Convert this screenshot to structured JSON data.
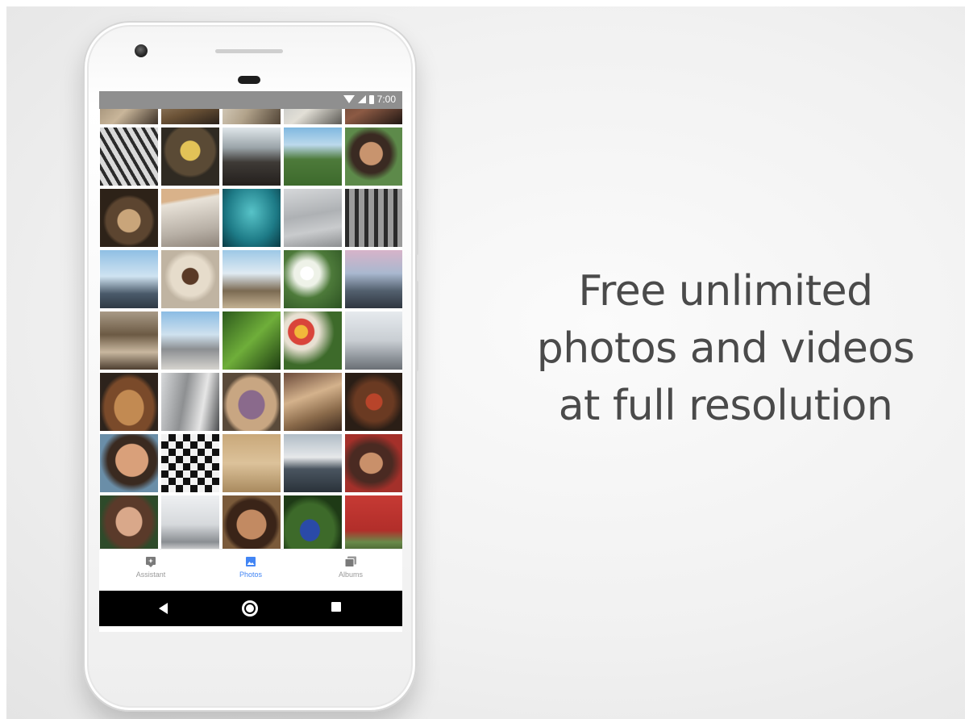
{
  "status_bar": {
    "time": "7:00"
  },
  "bottom_nav": {
    "items": [
      {
        "label": "Assistant",
        "icon": "assistant-icon",
        "active": false
      },
      {
        "label": "Photos",
        "icon": "photos-icon",
        "active": true
      },
      {
        "label": "Albums",
        "icon": "albums-icon",
        "active": false
      }
    ],
    "active_color": "#4285f4"
  },
  "system_nav": {
    "buttons": [
      "back-icon",
      "home-icon",
      "overview-icon"
    ]
  },
  "headline": {
    "line1": "Free unlimited",
    "line2": "photos and videos",
    "line3": "at full resolution"
  }
}
